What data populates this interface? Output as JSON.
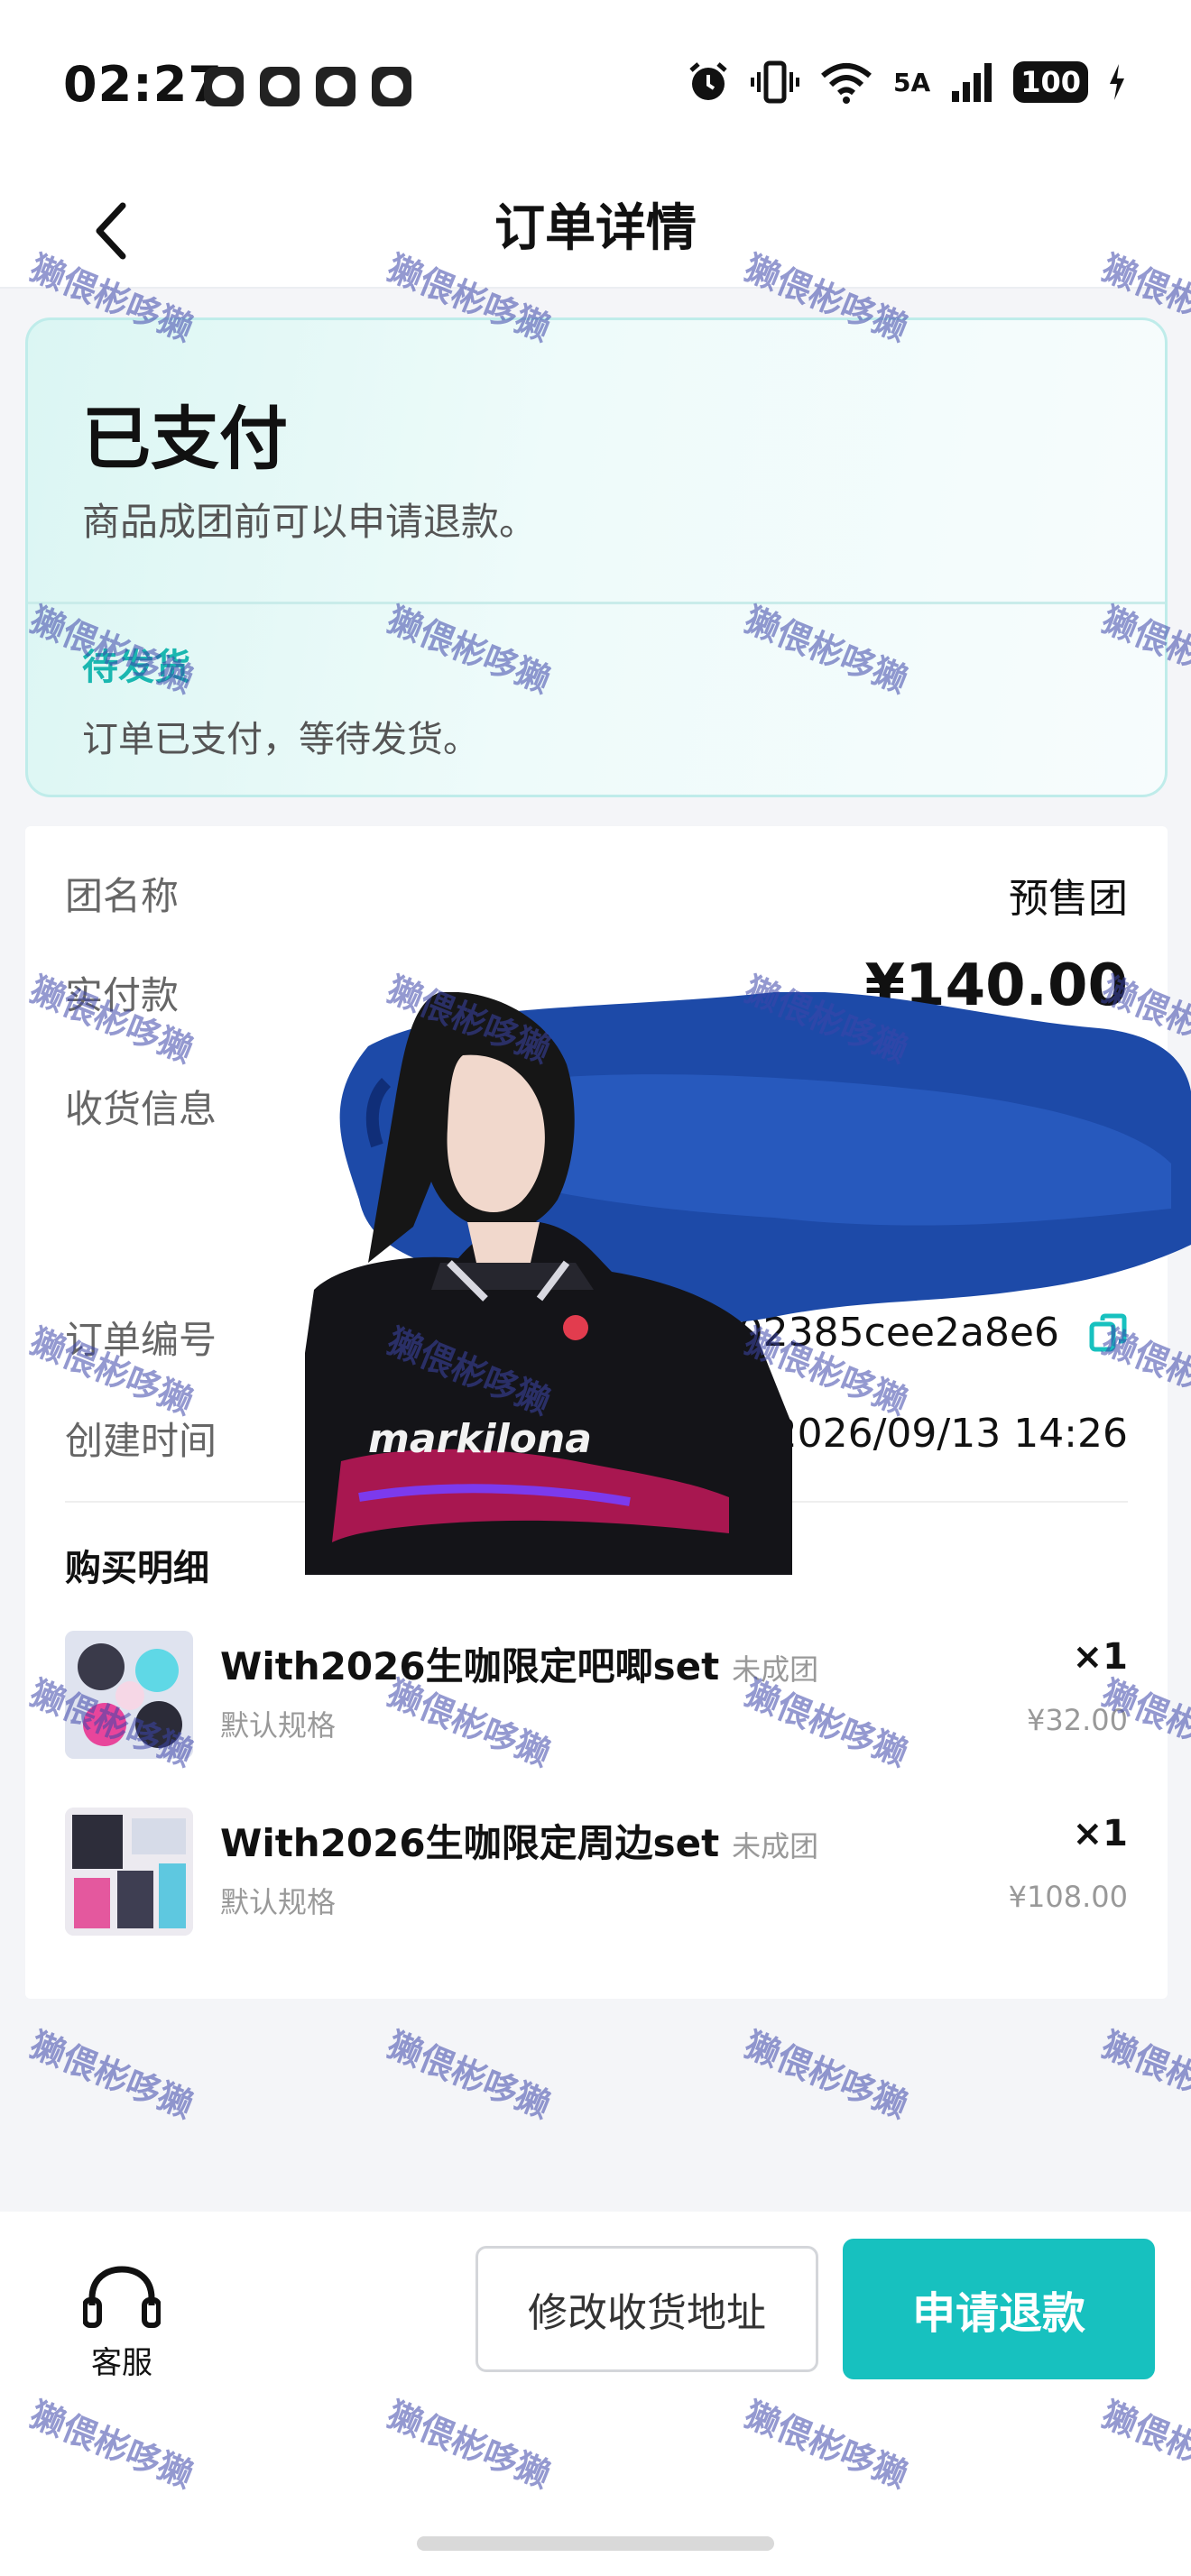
{
  "status_bar": {
    "time": "02:27",
    "network_label": "5A",
    "battery": "100"
  },
  "nav": {
    "title": "订单详情"
  },
  "order_status": {
    "title": "已支付",
    "description": "商品成团前可以申请退款。",
    "shipping_status": "待发货",
    "shipping_description": "订单已支付，等待发货。"
  },
  "info": {
    "group_label": "团名称",
    "group_value": "预售团",
    "paid_label": "实付款",
    "paid_value": "¥140.00",
    "shipping_info_label": "收货信息",
    "order_no_label": "订单编号",
    "order_no_value": "626502385cee2a8e6",
    "created_label": "创建时间",
    "created_value": "2026/09/13 14:26"
  },
  "purchase": {
    "section_title": "购买明细",
    "items": [
      {
        "name": "With2026生咖限定吧唧set",
        "tag": "未成团",
        "spec": "默认规格",
        "qty": "×1",
        "price": "¥32.00"
      },
      {
        "name": "With2026生咖限定周边set",
        "tag": "未成团",
        "spec": "默认规格",
        "qty": "×1",
        "price": "¥108.00"
      }
    ]
  },
  "photo_text": "markilona",
  "watermark": "獭偎彬哆獭",
  "bottom": {
    "service_label": "客服",
    "address_button": "修改收货地址",
    "refund_button": "申请退款"
  },
  "colors": {
    "accent": "#17c1bf",
    "accent_text": "#1ab7b0",
    "watermark": "#3c46aa"
  },
  "icons": [
    "alarm-icon",
    "vibrate-icon",
    "wifi-icon",
    "signal-icon",
    "battery-icon",
    "back-arrow-icon",
    "copy-icon",
    "headset-icon"
  ]
}
